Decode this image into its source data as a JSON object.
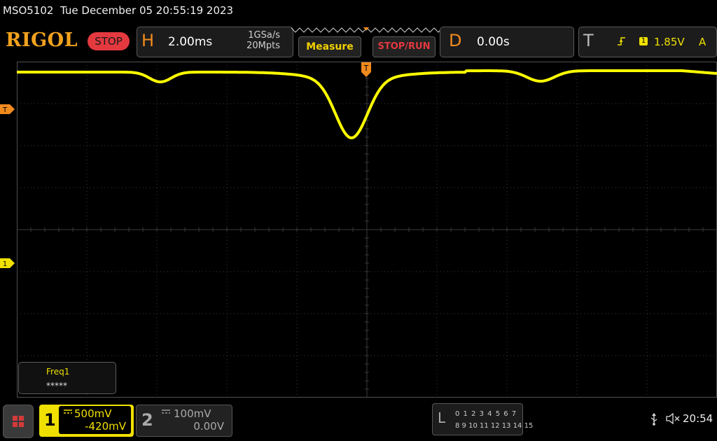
{
  "status": {
    "model": "MSO5102",
    "datetime": "Tue December 05 20:55:19 2023"
  },
  "header": {
    "logo": "RIGOL",
    "run_state": "STOP",
    "horizontal": {
      "letter": "H",
      "timebase": "2.00ms",
      "sample_rate": "1GSa/s",
      "memory_depth": "20Mpts"
    },
    "measure_label": "Measure",
    "stop_run_label": "STOP/RUN",
    "delay": {
      "letter": "D",
      "value": "0.00s"
    },
    "trigger": {
      "letter": "T",
      "edge_icon": "rising-edge-icon",
      "source": "1",
      "level": "1.85V",
      "mode": "A"
    }
  },
  "markers": {
    "trigger_position": "T",
    "trigger_level": "T",
    "ch1_ground": "1"
  },
  "measurement": {
    "label": "Freq1",
    "value": "*****"
  },
  "channels": [
    {
      "number": "1",
      "coupling_icon": "dc-coupling-icon",
      "scale": "500mV",
      "offset": "-420mV",
      "active": true,
      "color": "#f0e000"
    },
    {
      "number": "2",
      "coupling_icon": "dc-coupling-icon",
      "scale": "100mV",
      "offset": "0.00V",
      "active": false,
      "color": "#aaaaaa"
    }
  ],
  "logic": {
    "letter": "L",
    "row1": "0 1 2 3  4 5 6 7",
    "row2": "8 9 10 11 12 13 14 15"
  },
  "system": {
    "usb_icon": "usb-icon",
    "sound_icon": "mute-icon",
    "clock": "20:54"
  },
  "colors": {
    "ch1_trace": "#ffff00",
    "trigger_orange": "#f28a1e",
    "stop_red": "#e3393f",
    "grid": "#3a3a3a"
  }
}
